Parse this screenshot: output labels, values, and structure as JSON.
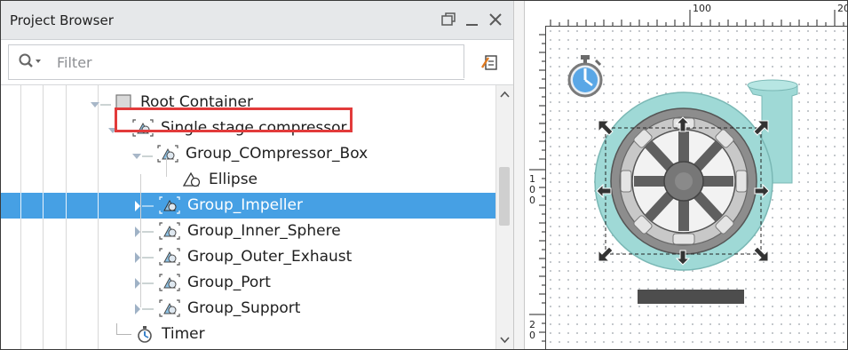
{
  "project_browser": {
    "title": "Project Browser",
    "filter_placeholder": "Filter",
    "tree": [
      {
        "label": "Root Container",
        "icon": "container-icon",
        "expander": "expanded"
      },
      {
        "label": "Single stage compressor",
        "icon": "group-icon",
        "expander": "expanded"
      },
      {
        "label": "Group_COmpressor_Box",
        "icon": "group-icon",
        "expander": "expanded"
      },
      {
        "label": "Ellipse",
        "icon": "shape-icon",
        "expander": "none"
      },
      {
        "label": "Group_Impeller",
        "icon": "group-icon",
        "expander": "collapsed",
        "selected": true
      },
      {
        "label": "Group_Inner_Sphere",
        "icon": "group-icon",
        "expander": "collapsed"
      },
      {
        "label": "Group_Outer_Exhaust",
        "icon": "group-icon",
        "expander": "collapsed"
      },
      {
        "label": "Group_Port",
        "icon": "group-icon",
        "expander": "collapsed"
      },
      {
        "label": "Group_Support",
        "icon": "group-icon",
        "expander": "collapsed"
      },
      {
        "label": "Timer",
        "icon": "timer-icon",
        "expander": "none"
      }
    ]
  },
  "designer": {
    "ruler_top_labels": [
      "100",
      "20"
    ],
    "ruler_left_labels": [
      [
        "1",
        "0",
        "0"
      ],
      [
        "2",
        "0"
      ]
    ]
  },
  "colors": {
    "selection": "#46a0e4",
    "highlight_border": "#e23b3b",
    "header_bg": "#e6e8ea",
    "pump_teal": "#9fd9d6"
  }
}
